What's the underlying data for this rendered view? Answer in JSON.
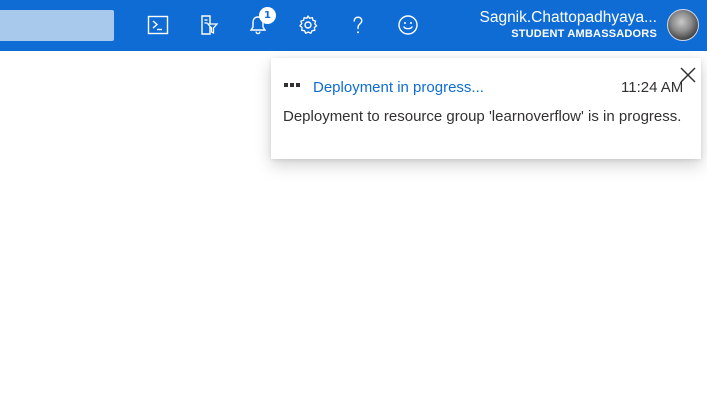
{
  "topbar": {
    "background_color": "#0f6cd4",
    "search": {
      "value": ""
    },
    "icons": [
      {
        "name": "cloud-shell-icon"
      },
      {
        "name": "directory-filter-icon"
      },
      {
        "name": "notifications-icon",
        "badge": "1"
      },
      {
        "name": "settings-icon"
      },
      {
        "name": "help-icon"
      },
      {
        "name": "feedback-icon"
      }
    ],
    "account": {
      "user_name": "Sagnik.Chattopadhyaya...",
      "tenant": "STUDENT AMBASSADORS"
    }
  },
  "notification": {
    "title": "Deployment in progress...",
    "time": "11:24 AM",
    "message": "Deployment to resource group 'learnoverflow' is in progress.",
    "accent_color": "#0f6cd4"
  }
}
